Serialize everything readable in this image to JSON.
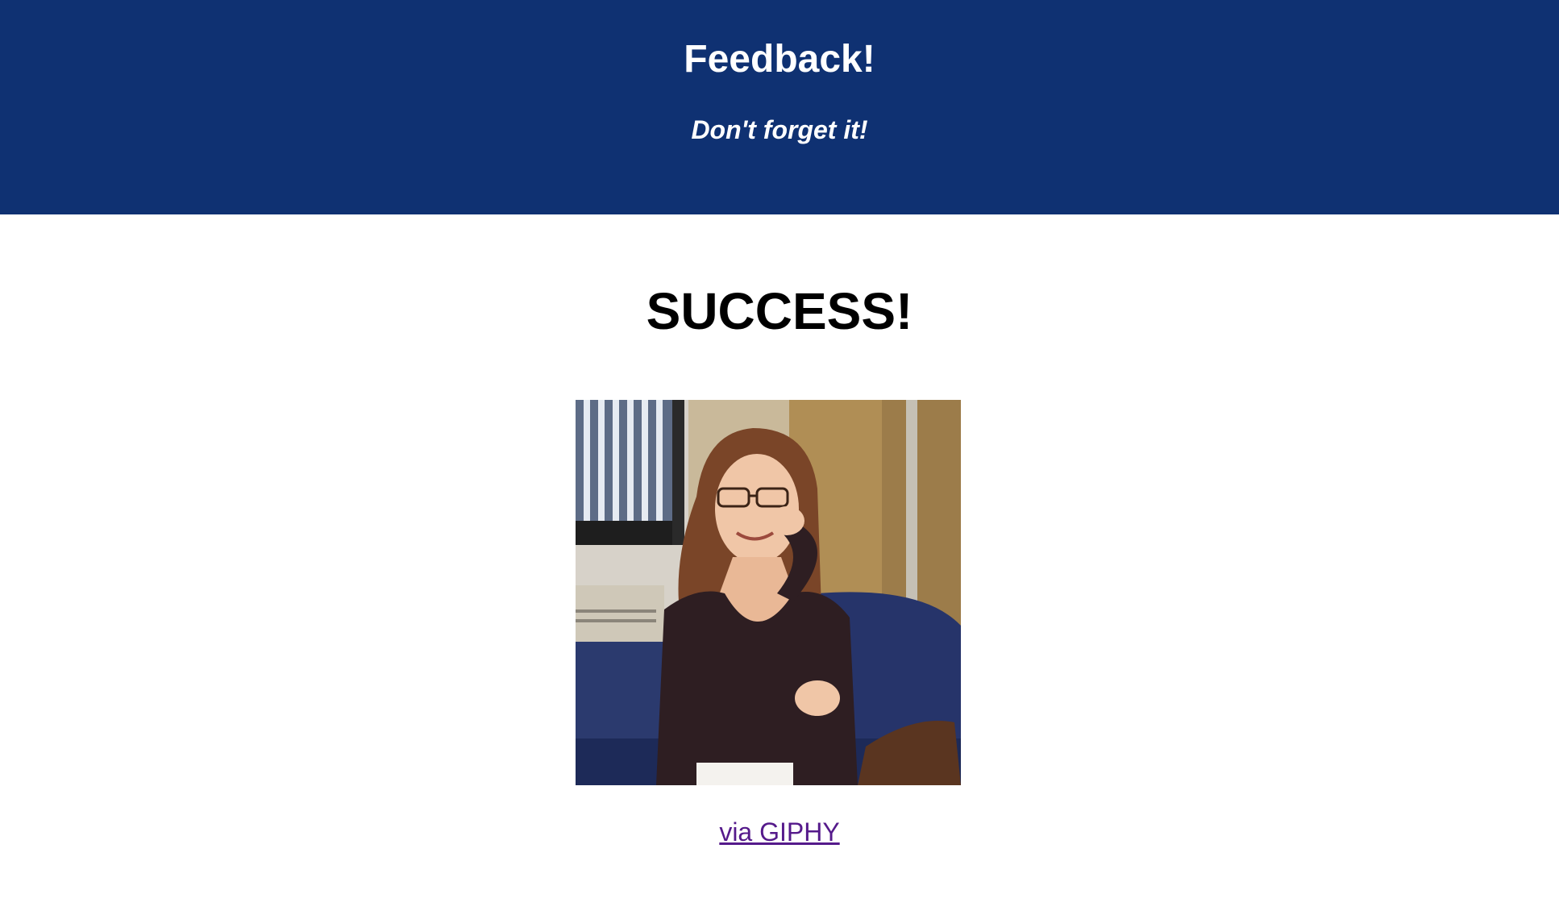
{
  "header": {
    "title": "Feedback!",
    "subtitle": "Don't forget it!"
  },
  "main": {
    "heading": "SUCCESS!",
    "gif_link_label": "via GIPHY"
  },
  "colors": {
    "header_background": "#0f3172",
    "header_text": "#ffffff",
    "link_visited": "#551a8b"
  }
}
